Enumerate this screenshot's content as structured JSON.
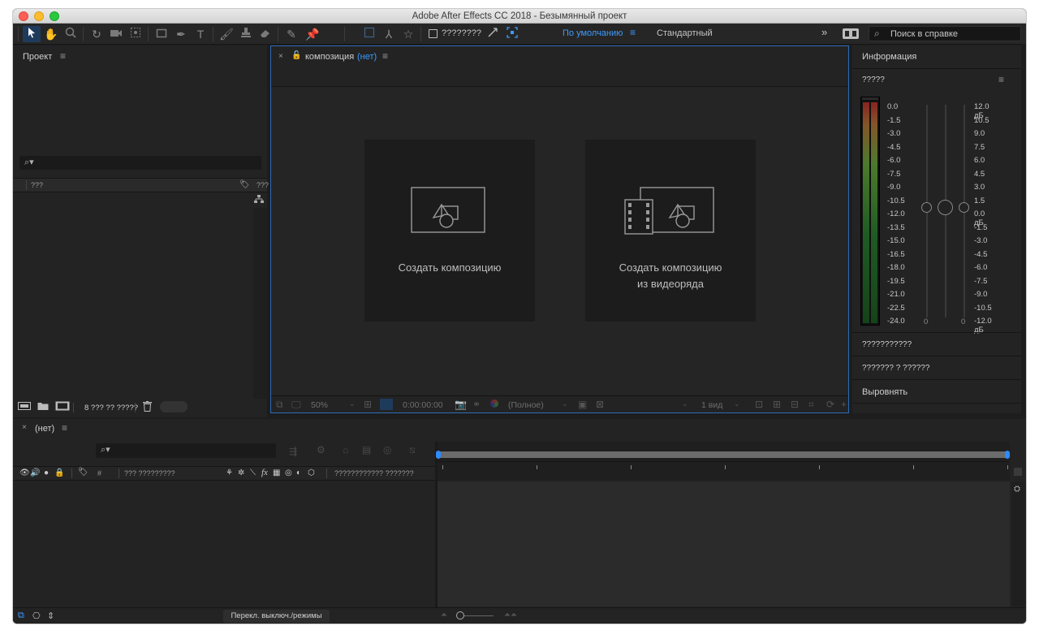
{
  "window": {
    "title": "Adobe After Effects CC 2018 - Безымянный проект"
  },
  "toolbar": {
    "snap_label": "????????",
    "workspace_default": "По умолчанию",
    "workspace_standard": "Стандартный",
    "more": "»",
    "help_placeholder": "Поиск в справке"
  },
  "project": {
    "title": "Проект",
    "col_name": "???",
    "col_type": "???",
    "footer_bpc": "8 ??? ?? ?????"
  },
  "composition": {
    "title_prefix": "композиция",
    "title_none": "(нет)",
    "card_new": "Создать композицию",
    "card_from_footage_line1": "Создать композицию",
    "card_from_footage_line2": "из видеоряда",
    "zoom": "50%",
    "timecode": "0:00:00:00",
    "resolution": "(Полное)",
    "views": "1 вид"
  },
  "info_panel": {
    "title": "Информация",
    "audio_title": "?????",
    "left_scale": [
      "0.0",
      "-1.5",
      "-3.0",
      "-4.5",
      "-6.0",
      "-7.5",
      "-9.0",
      "-10.5",
      "-12.0",
      "-13.5",
      "-15.0",
      "-16.5",
      "-18.0",
      "-19.5",
      "-21.0",
      "-22.5",
      "-24.0"
    ],
    "right_scale": [
      "12.0 дБ",
      "10.5",
      "9.0",
      "7.5",
      "6.0",
      "4.5",
      "3.0",
      "1.5",
      "0.0 дБ",
      "-1.5",
      "-3.0",
      "-4.5",
      "-6.0",
      "-7.5",
      "-9.0",
      "-10.5",
      "-12.0 дБ"
    ],
    "slider_left_value": "0",
    "slider_right_value": "0",
    "section1": "???????????",
    "section2": "??????? ? ??????",
    "section3": "Выровнять"
  },
  "timeline": {
    "title": "(нет)",
    "col_number": "#",
    "col_source": "??? ?????????",
    "col_parent": "???????????? ???????",
    "fx_label": "fx",
    "toggle_modes": "Перекл. выключ./режимы"
  }
}
